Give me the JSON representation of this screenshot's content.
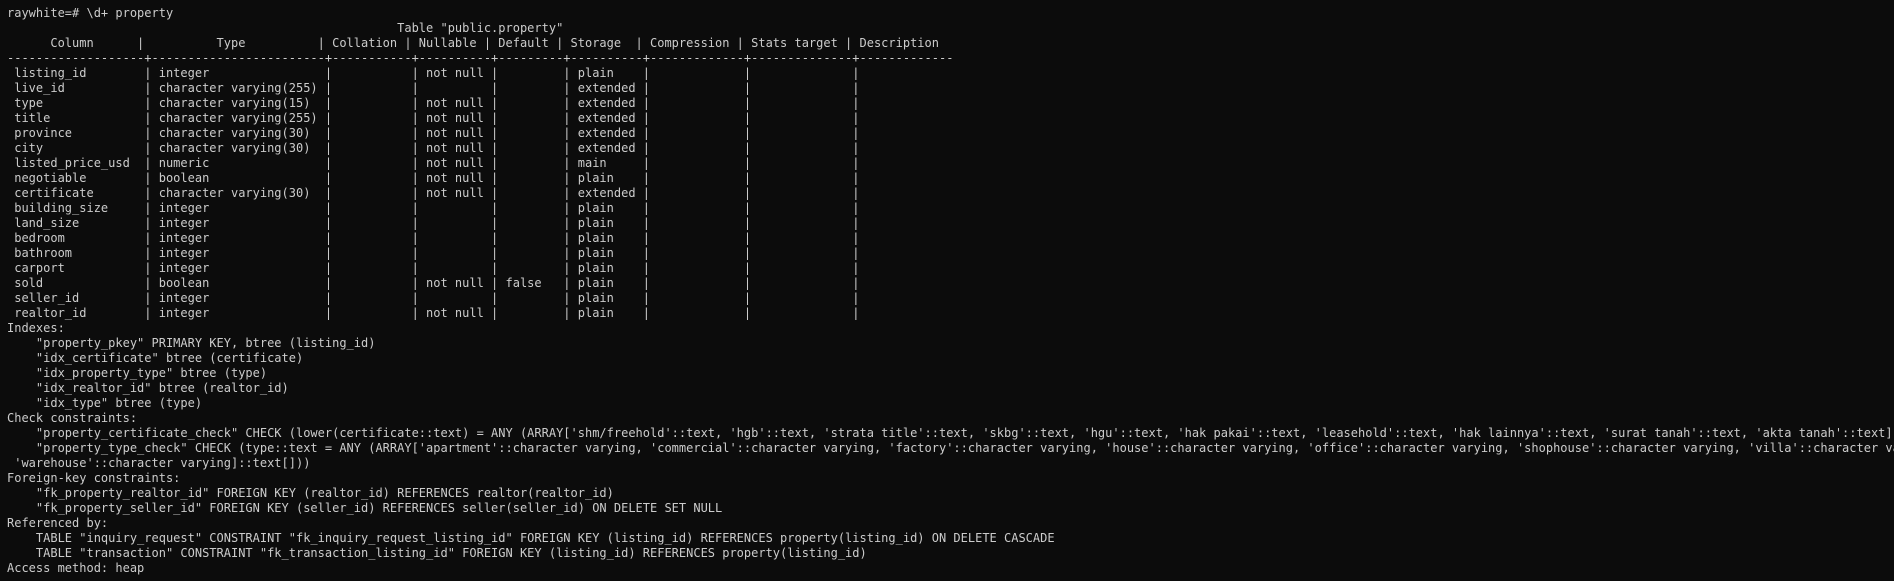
{
  "terminal": {
    "background": "#0c0c0c",
    "foreground": "#cccccc",
    "lines": [
      "raywhite=# \\d+ property",
      "                                                      Table \"public.property\"",
      "      Column      |          Type          | Collation | Nullable | Default | Storage  | Compression | Stats target | Description",
      "-------------------+------------------------+-----------+----------+---------+----------+-------------+--------------+-------------",
      " listing_id        | integer                |           | not null |         | plain    |             |              |",
      " live_id           | character varying(255) |           |          |         | extended |             |              |",
      " type              | character varying(15)  |           | not null |         | extended |             |              |",
      " title             | character varying(255) |           | not null |         | extended |             |              |",
      " province          | character varying(30)  |           | not null |         | extended |             |              |",
      " city              | character varying(30)  |           | not null |         | extended |             |              |",
      " listed_price_usd  | numeric                |           | not null |         | main     |             |              |",
      " negotiable        | boolean                |           | not null |         | plain    |             |              |",
      " certificate       | character varying(30)  |           | not null |         | extended |             |              |",
      " building_size     | integer                |           |          |         | plain    |             |              |",
      " land_size         | integer                |           |          |         | plain    |             |              |",
      " bedroom           | integer                |           |          |         | plain    |             |              |",
      " bathroom          | integer                |           |          |         | plain    |             |              |",
      " carport           | integer                |           |          |         | plain    |             |              |",
      " sold              | boolean                |           | not null | false   | plain    |             |              |",
      " seller_id         | integer                |           |          |         | plain    |             |              |",
      " realtor_id        | integer                |           | not null |         | plain    |             |              |",
      "Indexes:",
      "    \"property_pkey\" PRIMARY KEY, btree (listing_id)",
      "    \"idx_certificate\" btree (certificate)",
      "    \"idx_property_type\" btree (type)",
      "    \"idx_realtor_id\" btree (realtor_id)",
      "    \"idx_type\" btree (type)",
      "Check constraints:",
      "    \"property_certificate_check\" CHECK (lower(certificate::text) = ANY (ARRAY['shm/freehold'::text, 'hgb'::text, 'strata title'::text, 'skbg'::text, 'hgu'::text, 'hak pakai'::text, 'leasehold'::text, 'hak lainnya'::text, 'surat tanah'::text, 'akta tanah'::text]))",
      "    \"property_type_check\" CHECK (type::text = ANY (ARRAY['apartment'::character varying, 'commercial'::character varying, 'factory'::character varying, 'house'::character varying, 'office'::character varying, 'shophouse'::character varying, 'villa'::character varying,",
      " 'warehouse'::character varying]::text[]))",
      "Foreign-key constraints:",
      "    \"fk_property_realtor_id\" FOREIGN KEY (realtor_id) REFERENCES realtor(realtor_id)",
      "    \"fk_property_seller_id\" FOREIGN KEY (seller_id) REFERENCES seller(seller_id) ON DELETE SET NULL",
      "Referenced by:",
      "    TABLE \"inquiry_request\" CONSTRAINT \"fk_inquiry_request_listing_id\" FOREIGN KEY (listing_id) REFERENCES property(listing_id) ON DELETE CASCADE",
      "    TABLE \"transaction\" CONSTRAINT \"fk_transaction_listing_id\" FOREIGN KEY (listing_id) REFERENCES property(listing_id)",
      "Access method: heap"
    ]
  }
}
